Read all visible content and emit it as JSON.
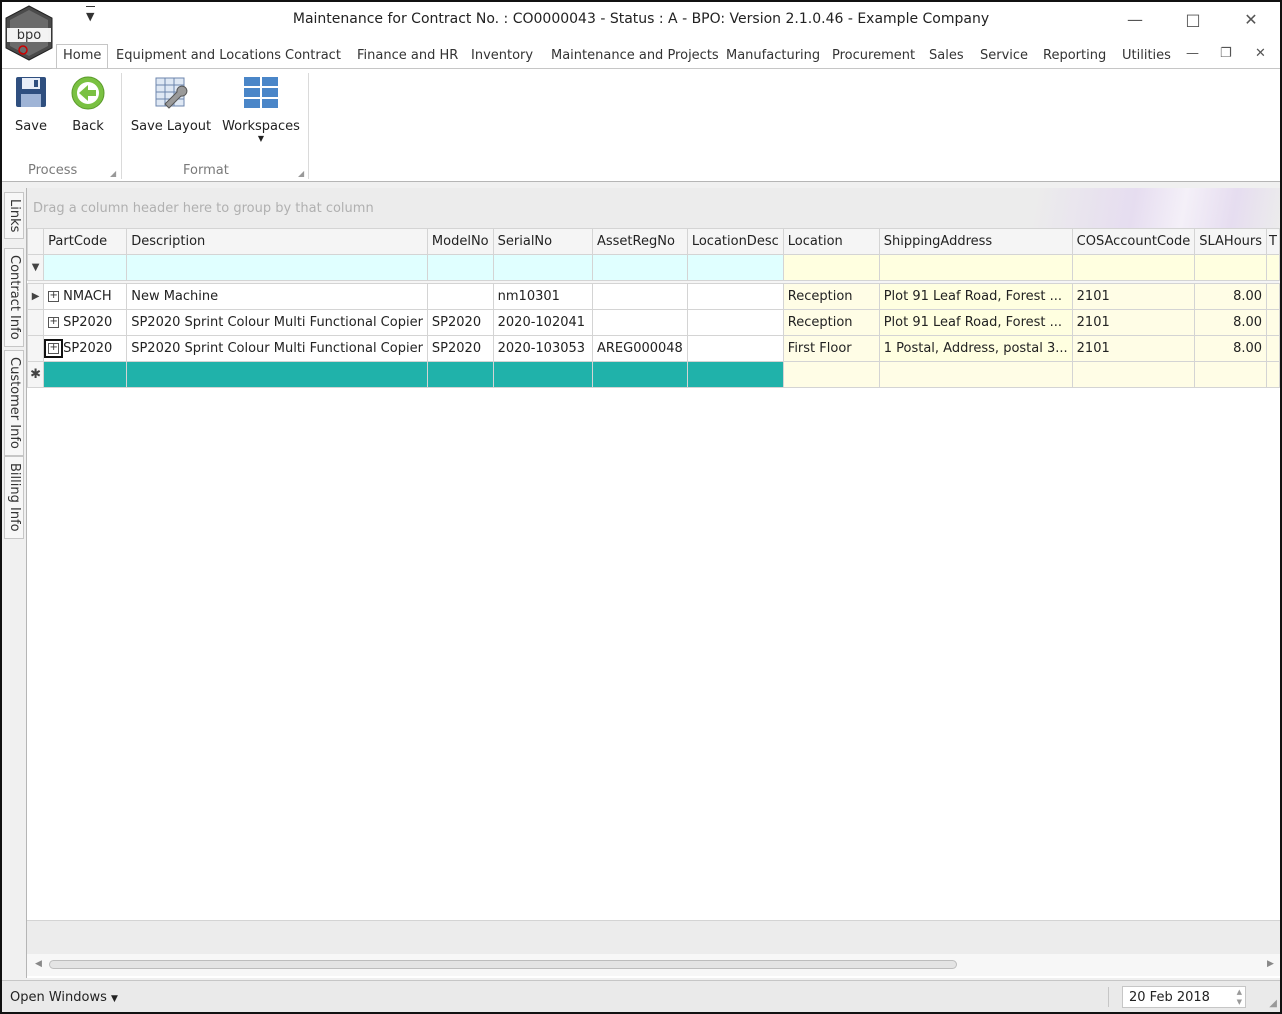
{
  "window": {
    "title": "Maintenance for Contract No. : CO0000043 - Status : A - BPO: Version 2.1.0.46 - Example Company",
    "logo_text": "bpo"
  },
  "tabs": [
    {
      "label": "Home",
      "active": true
    },
    {
      "label": "Equipment and Locations"
    },
    {
      "label": "Contract"
    },
    {
      "label": "Finance and HR"
    },
    {
      "label": "Inventory"
    },
    {
      "label": "Maintenance and Projects"
    },
    {
      "label": "Manufacturing"
    },
    {
      "label": "Procurement"
    },
    {
      "label": "Sales"
    },
    {
      "label": "Service"
    },
    {
      "label": "Reporting"
    },
    {
      "label": "Utilities"
    }
  ],
  "ribbon": {
    "save": "Save",
    "back": "Back",
    "save_layout": "Save Layout",
    "workspaces": "Workspaces",
    "group_process": "Process",
    "group_format": "Format"
  },
  "side_tabs": [
    "Links",
    "Contract Info",
    "Customer Info",
    "Billing Info"
  ],
  "grid": {
    "group_hint": "Drag a column header here to group by that column",
    "columns": [
      "PartCode",
      "Description",
      "ModelNo",
      "SerialNo",
      "AssetRegNo",
      "LocationDesc",
      "Location",
      "ShippingAddress",
      "COSAccountCode",
      "SLAHours",
      "T"
    ],
    "rows": [
      [
        "NMACH",
        "New Machine",
        "",
        "nm10301",
        "",
        "",
        "Reception",
        "Plot 91 Leaf Road, Forest ...",
        "2101",
        "8.00"
      ],
      [
        "SP2020",
        "SP2020 Sprint Colour Multi Functional Copier",
        "SP2020",
        "2020-102041",
        "",
        "",
        "Reception",
        "Plot 91 Leaf Road, Forest ...",
        "2101",
        "8.00"
      ],
      [
        "SP2020",
        "SP2020 Sprint Colour Multi Functional Copier",
        "SP2020",
        "2020-103053",
        "AREG000048",
        "",
        "First Floor",
        "1 Postal, Address, postal 3...",
        "2101",
        "8.00"
      ]
    ]
  },
  "status": {
    "open_windows": "Open Windows",
    "date": "20 Feb 2018"
  },
  "colors": {
    "new_row": "#20b2aa",
    "filter_row": "#e0ffff",
    "editable_cell": "#fffde6"
  }
}
